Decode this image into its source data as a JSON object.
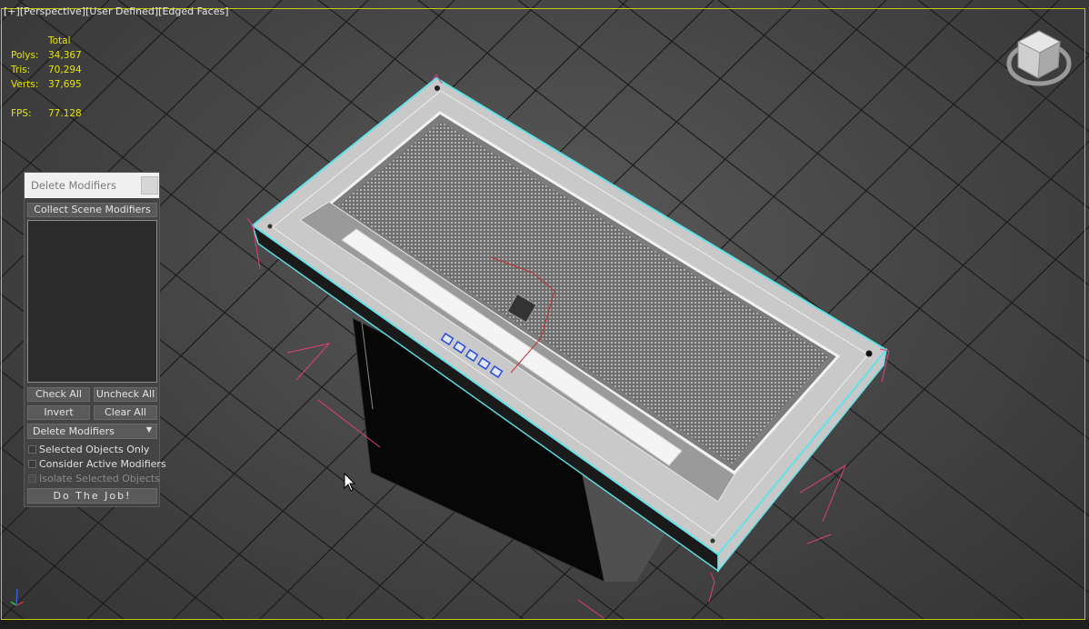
{
  "viewport": {
    "labels": [
      "[+]",
      "[Perspective]",
      "[User Defined]",
      "[Edged Faces]"
    ],
    "border_color": "#c8c800"
  },
  "stats": {
    "header": "Total",
    "rows": [
      {
        "label": "Polys:",
        "value": "34,367"
      },
      {
        "label": "Tris:",
        "value": "70,294"
      },
      {
        "label": "Verts:",
        "value": "37,695"
      }
    ],
    "fps_label": "FPS:",
    "fps_value": "77.128",
    "color": "#e6e600"
  },
  "dialog": {
    "title": "Delete Modifiers",
    "collect_label": "Collect Scene Modifiers",
    "check_all_label": "Check All",
    "uncheck_all_label": "Uncheck All",
    "invert_label": "Invert",
    "clear_all_label": "Clear All",
    "mode_selected": "Delete Modifiers",
    "options": [
      {
        "label": "Selected Objects Only",
        "checked": false,
        "enabled": true
      },
      {
        "label": "Consider Active Modifiers",
        "checked": false,
        "enabled": true
      },
      {
        "label": "Isolate Selected Objects",
        "checked": false,
        "enabled": false
      }
    ],
    "run_label": "Do The Job!"
  },
  "icons": {
    "viewcube": "viewcube-icon",
    "axis": "axis-tripod-icon",
    "cursor": "mouse-cursor-icon",
    "dropdown": "chevron-down-icon",
    "close": "close-icon"
  },
  "colors": {
    "selection_outline": "#5fe3e8",
    "bounding_brackets": "#e0407a",
    "grid": "#1a1a1a"
  }
}
